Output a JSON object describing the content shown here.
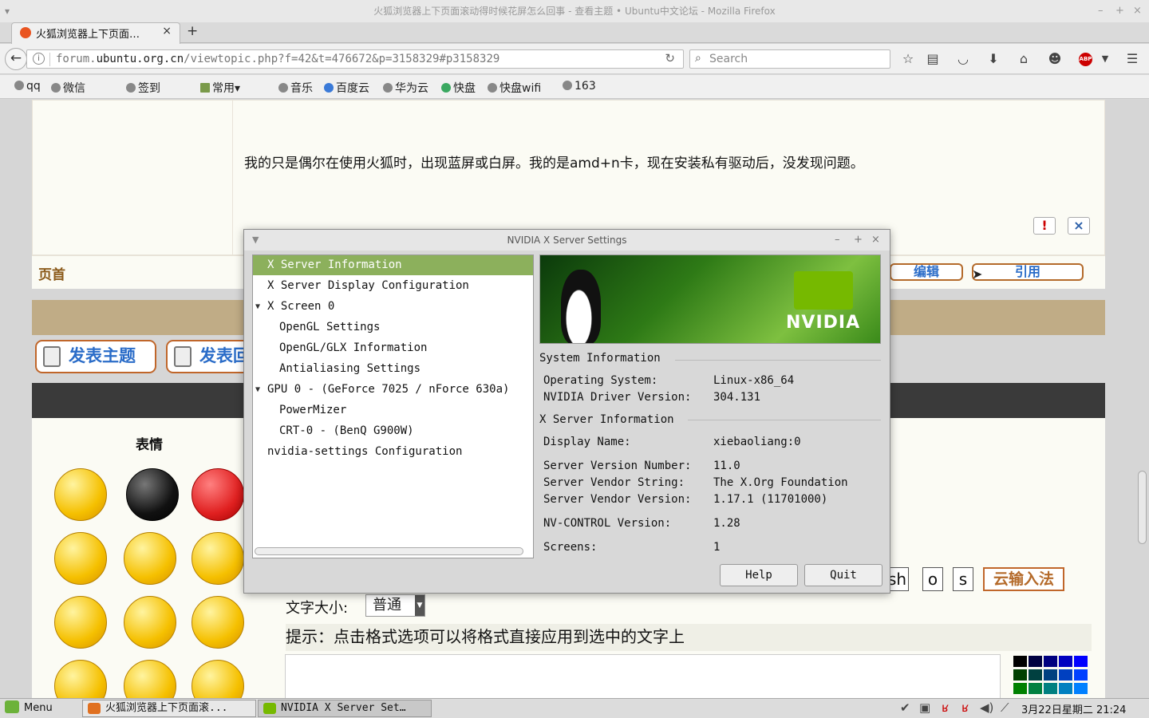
{
  "window": {
    "title": "火狐浏览器上下页面滚动得时候花屏怎么回事 - 查看主题 • Ubuntu中文论坛 - Mozilla Firefox"
  },
  "tab": {
    "label": "火狐浏览器上下页面…",
    "close": "×",
    "new": "+"
  },
  "nav": {
    "url_prefix": "forum.",
    "url_domain": "ubuntu.org.cn",
    "url_path": "/viewtopic.php?f=42&t=476672&p=3158329#p3158329",
    "search_placeholder": "Search",
    "abp": "ABP"
  },
  "bookmarks": [
    "qq",
    "微信",
    "签到",
    "常用",
    "音乐",
    "百度云",
    "华为云",
    "快盘",
    "快盘wifi",
    "163"
  ],
  "page": {
    "post_text": "我的只是偶尔在使用火狐时，出现蓝屏或白屏。我的是amd+n卡，现在安装私有驱动后，没发现问题。",
    "report": "!",
    "close": "×",
    "top_link": "页首",
    "edit": "编辑",
    "quote": "引用",
    "post_buttons": [
      "发表主题",
      "发表回复"
    ],
    "smileys_title": "表情",
    "format_buttons": [
      "sh",
      "o",
      "s"
    ],
    "cloud_ime": "云输入法",
    "font_size_label": "文字大小:",
    "font_size_value": "普通",
    "hint": "提示：点击格式选项可以将格式直接应用到选中的文字上"
  },
  "dialog": {
    "title": "NVIDIA X Server Settings",
    "tree": [
      {
        "label": "X Server Information",
        "indent": 0,
        "selected": true
      },
      {
        "label": "X Server Display Configuration",
        "indent": 0
      },
      {
        "label": "X Screen 0",
        "indent": 0,
        "expander": "▼"
      },
      {
        "label": "OpenGL Settings",
        "indent": 1
      },
      {
        "label": "OpenGL/GLX Information",
        "indent": 1
      },
      {
        "label": "Antialiasing Settings",
        "indent": 1
      },
      {
        "label": "GPU 0 - (GeForce 7025 / nForce 630a)",
        "indent": 0,
        "expander": "▼"
      },
      {
        "label": "PowerMizer",
        "indent": 1
      },
      {
        "label": "CRT-0 - (BenQ G900W)",
        "indent": 1
      },
      {
        "label": "nvidia-settings Configuration",
        "indent": 0
      }
    ],
    "brand": "NVIDIA",
    "system_info_title": "System Information",
    "os_label": "Operating System:",
    "os_value": "Linux-x86_64",
    "driver_label": "NVIDIA Driver Version:",
    "driver_value": "304.131",
    "xserver_title": "X Server Information",
    "display_label": "Display Name:",
    "display_value": "xiebaoliang:0",
    "version_label": "Server Version Number:",
    "version_value": "11.0",
    "vendor_label": "Server Vendor String:",
    "vendor_value": "The X.Org Foundation",
    "vendor_ver_label": "Server Vendor Version:",
    "vendor_ver_value": "1.17.1 (11701000)",
    "nvcontrol_label": "NV-CONTROL Version:",
    "nvcontrol_value": "1.28",
    "screens_label": "Screens:",
    "screens_value": "1",
    "help": "Help",
    "quit": "Quit"
  },
  "taskbar": {
    "menu": "Menu",
    "tasks": [
      "火狐浏览器上下页面滚...",
      "NVIDIA X Server Set…"
    ],
    "clock": "3月22日星期二 21:24"
  },
  "colors": {
    "tree_selected": "#8cb05c",
    "brown_bar": "#c0ac86",
    "dark_bar": "#3a3a3a",
    "button_border": "#c0662a",
    "button_text": "#2a6cc8",
    "nvidia_green": "#76b900"
  }
}
